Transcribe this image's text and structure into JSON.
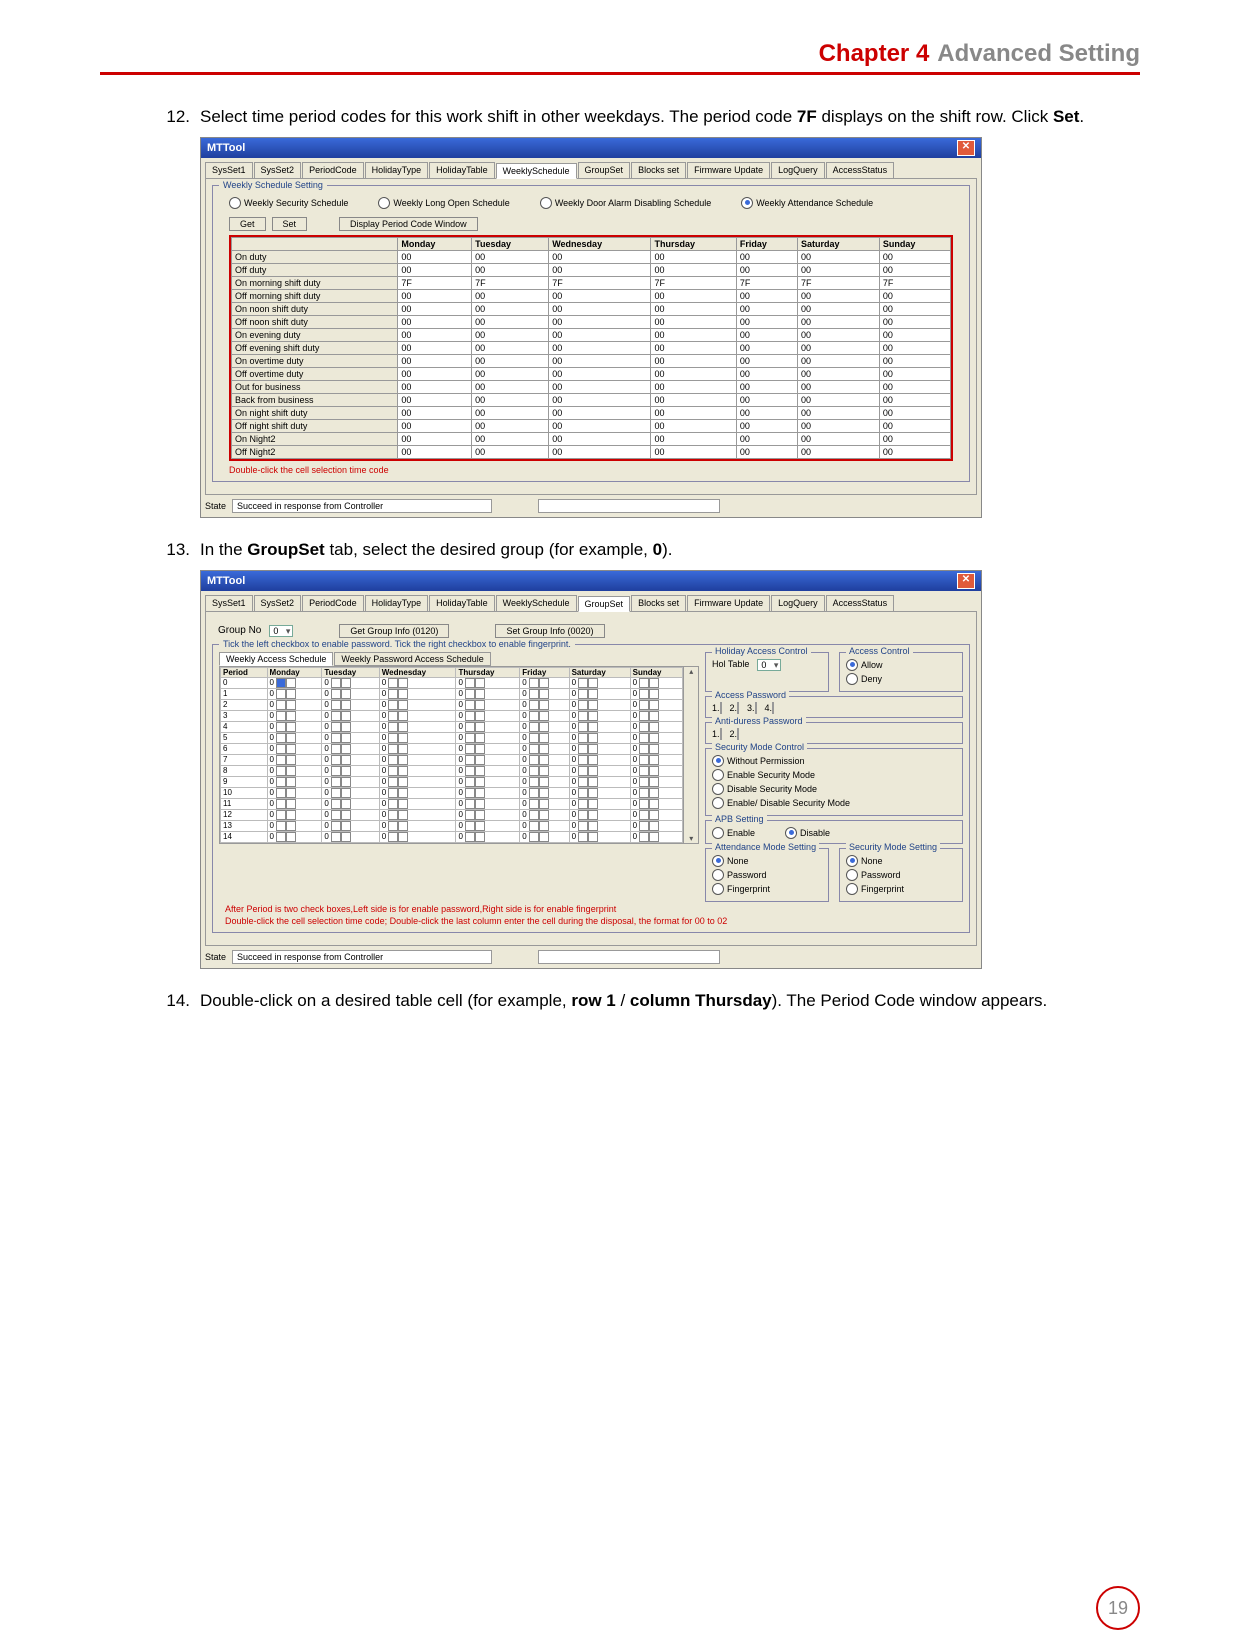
{
  "header": {
    "chapter": "Chapter 4",
    "title": "Advanced Setting"
  },
  "step12": {
    "num": "12.",
    "text_a": "Select time period codes for this work shift in other weekdays. The period code ",
    "bold_a": "7F",
    "text_b": " displays on the shift row. Click ",
    "bold_b": "Set",
    "text_c": "."
  },
  "step13": {
    "num": "13.",
    "text_a": "In the ",
    "bold_a": "GroupSet",
    "text_b": " tab, select the desired group (for example, ",
    "bold_b": "0",
    "text_c": ")."
  },
  "step14": {
    "num": "14.",
    "text_a": "Double-click on a desired table cell (for example, ",
    "bold_a": "row 1",
    "text_b": " / ",
    "bold_b": "column Thursday",
    "text_c": "). The Period Code window appears."
  },
  "app": {
    "title": "MTTool",
    "tabs": [
      "SysSet1",
      "SysSet2",
      "PeriodCode",
      "HolidayType",
      "HolidayTable",
      "WeeklySchedule",
      "GroupSet",
      "Blocks set",
      "Firmware Update",
      "LogQuery",
      "AccessStatus"
    ]
  },
  "screen1": {
    "selected_tab": "WeeklySchedule",
    "fieldset_title": "Weekly Schedule Setting",
    "radios": [
      "Weekly Security Schedule",
      "Weekly Long Open Schedule",
      "Weekly Door Alarm Disabling Schedule",
      "Weekly Attendance Schedule"
    ],
    "radio_selected": 3,
    "buttons": [
      "Get",
      "Set",
      "Display Period Code Window"
    ],
    "cols": [
      "",
      "Monday",
      "Tuesday",
      "Wednesday",
      "Thursday",
      "Friday",
      "Saturday",
      "Sunday"
    ],
    "rows": [
      {
        "label": "On duty",
        "v": [
          "00",
          "00",
          "00",
          "00",
          "00",
          "00",
          "00"
        ]
      },
      {
        "label": "Off duty",
        "v": [
          "00",
          "00",
          "00",
          "00",
          "00",
          "00",
          "00"
        ]
      },
      {
        "label": "On morning shift duty",
        "v": [
          "7F",
          "7F",
          "7F",
          "7F",
          "7F",
          "7F",
          "7F"
        ]
      },
      {
        "label": "Off morning shift duty",
        "v": [
          "00",
          "00",
          "00",
          "00",
          "00",
          "00",
          "00"
        ]
      },
      {
        "label": "On noon shift duty",
        "v": [
          "00",
          "00",
          "00",
          "00",
          "00",
          "00",
          "00"
        ]
      },
      {
        "label": "Off noon shift duty",
        "v": [
          "00",
          "00",
          "00",
          "00",
          "00",
          "00",
          "00"
        ]
      },
      {
        "label": "On evening duty",
        "v": [
          "00",
          "00",
          "00",
          "00",
          "00",
          "00",
          "00"
        ]
      },
      {
        "label": "Off evening shift duty",
        "v": [
          "00",
          "00",
          "00",
          "00",
          "00",
          "00",
          "00"
        ]
      },
      {
        "label": "On overtime duty",
        "v": [
          "00",
          "00",
          "00",
          "00",
          "00",
          "00",
          "00"
        ]
      },
      {
        "label": "Off overtime duty",
        "v": [
          "00",
          "00",
          "00",
          "00",
          "00",
          "00",
          "00"
        ]
      },
      {
        "label": "Out for business",
        "v": [
          "00",
          "00",
          "00",
          "00",
          "00",
          "00",
          "00"
        ]
      },
      {
        "label": "Back from business",
        "v": [
          "00",
          "00",
          "00",
          "00",
          "00",
          "00",
          "00"
        ]
      },
      {
        "label": "On night shift duty",
        "v": [
          "00",
          "00",
          "00",
          "00",
          "00",
          "00",
          "00"
        ]
      },
      {
        "label": "Off night shift duty",
        "v": [
          "00",
          "00",
          "00",
          "00",
          "00",
          "00",
          "00"
        ]
      },
      {
        "label": "On Night2",
        "v": [
          "00",
          "00",
          "00",
          "00",
          "00",
          "00",
          "00"
        ]
      },
      {
        "label": "Off Night2",
        "v": [
          "00",
          "00",
          "00",
          "00",
          "00",
          "00",
          "00"
        ]
      }
    ],
    "hint": "Double-click the cell selection time code",
    "state_label": "State",
    "state_text": "Succeed in response from Controller"
  },
  "screen2": {
    "selected_tab": "GroupSet",
    "group_no_label": "Group No",
    "group_no_value": "0",
    "btn_get": "Get Group Info (0120)",
    "btn_set": "Set Group Info (0020)",
    "tick_legend": "Tick the left checkbox to enable password. Tick the right checkbox to enable fingerprint.",
    "inner_tabs": [
      "Weekly Access Schedule",
      "Weekly Password Access Schedule"
    ],
    "inner_selected": 0,
    "cols": [
      "Period",
      "Monday",
      "Tuesday",
      "Wednesday",
      "Thursday",
      "Friday",
      "Saturday",
      "Sunday"
    ],
    "periods": [
      "0",
      "1",
      "2",
      "3",
      "4",
      "5",
      "6",
      "7",
      "8",
      "9",
      "10",
      "11",
      "12",
      "13",
      "14"
    ],
    "cell_value": "0",
    "hint1": "After Period is two check boxes,Left side is for enable password,Right side is for enable fingerprint",
    "hint2": "Double-click the cell selection time code; Double-click the last column enter the cell during the disposal, the format for 00 to 02",
    "holiday_panel": {
      "title": "Holiday Access Control",
      "label": "Hol Table",
      "value": "0"
    },
    "access_panel": {
      "title": "Access Control",
      "opts": [
        "Allow",
        "Deny"
      ],
      "selected": 0
    },
    "access_pw": {
      "title": "Access Password",
      "labels": [
        "1.",
        "2.",
        "3.",
        "4."
      ]
    },
    "duress_pw": {
      "title": "Anti-duress Password",
      "labels": [
        "1.",
        "2."
      ]
    },
    "sec_mode": {
      "title": "Security Mode Control",
      "opts": [
        "Without Permission",
        "Enable Security Mode",
        "Disable Security Mode",
        "Enable/ Disable Security Mode"
      ],
      "selected": 0
    },
    "apb": {
      "title": "APB Setting",
      "opts": [
        "Enable",
        "Disable"
      ],
      "selected": 1
    },
    "att_mode": {
      "title": "Attendance Mode Setting",
      "opts": [
        "None",
        "Password",
        "Fingerprint"
      ],
      "selected": 0
    },
    "sec_mode_set": {
      "title": "Security Mode Setting",
      "opts": [
        "None",
        "Password",
        "Fingerprint"
      ],
      "selected": 0
    },
    "state_label": "State",
    "state_text": "Succeed in response from Controller"
  },
  "page_number": "19"
}
